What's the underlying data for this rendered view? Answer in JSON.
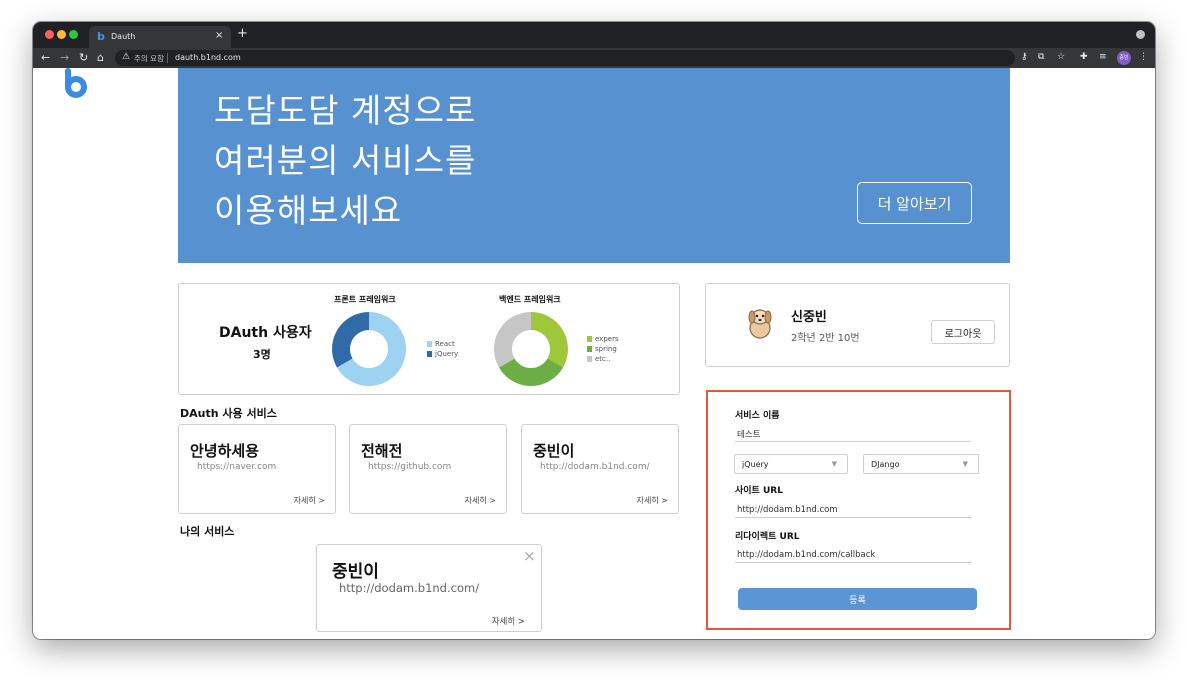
{
  "browser": {
    "tab_title": "Dauth",
    "tab_favicon": "b",
    "close_tab": "×",
    "new_tab": "+",
    "security_label": "주의 요함",
    "url": "dauth.b1nd.com",
    "profile_initials": "중빈",
    "icons": [
      "back-arrow-icon",
      "forward-arrow-icon",
      "reload-icon",
      "home-icon",
      "warning-icon",
      "key-icon",
      "translate-icon",
      "star-icon",
      "extensions-icon",
      "reading-list-icon",
      "menu-icon"
    ]
  },
  "hero": {
    "line1": "도담도담 계정으로",
    "line2": "여러분의 서비스를",
    "line3": "이용해보세요",
    "button": "더 알아보기",
    "color": "#5891cf"
  },
  "stats": {
    "users_title": "DAuth 사용자",
    "users_count": "3명",
    "front_title": "프론트 프레임워크",
    "back_title": "백엔드 프레임워크"
  },
  "chart_data": [
    {
      "type": "pie",
      "title": "프론트 프레임워크",
      "categories": [
        "React",
        "jQuery"
      ],
      "values": [
        2,
        1
      ],
      "colors": [
        "#9dd2f1",
        "#2e6ba8"
      ]
    },
    {
      "type": "pie",
      "title": "백엔드 프레임워크",
      "categories": [
        "expers",
        "spring",
        "etc.."
      ],
      "values": [
        1,
        1,
        1
      ],
      "colors": [
        "#9ec73b",
        "#6cad46",
        "#c6c6c6"
      ]
    }
  ],
  "services": {
    "section_title": "DAuth 사용 서비스",
    "items": [
      {
        "name": "안녕하세용",
        "url": "https://naver.com",
        "more": "자세히 >"
      },
      {
        "name": "전해전",
        "url": "https://github.com",
        "more": "자세히 >"
      },
      {
        "name": "중빈이",
        "url": "http://dodam.b1nd.com/",
        "more": "자세히 >"
      }
    ]
  },
  "my_services": {
    "section_title": "나의 서비스",
    "items": [
      {
        "name": "중빈이",
        "url": "http://dodam.b1nd.com/",
        "more": "자세히 >",
        "close": "×"
      }
    ]
  },
  "profile": {
    "name": "신중빈",
    "info": "2학년 2반 10번",
    "logout": "로그아웃"
  },
  "form": {
    "service_name_label": "서비스 이름",
    "service_name_value": "테스트",
    "front_select": "jQuery",
    "back_select": "DJango",
    "site_url_label": "사이트 URL",
    "site_url_value": "http://dodam.b1nd.com",
    "redirect_url_label": "리다이렉트 URL",
    "redirect_url_value": "http://dodam.b1nd.com/callback",
    "submit": "등록",
    "caret": "▼"
  }
}
